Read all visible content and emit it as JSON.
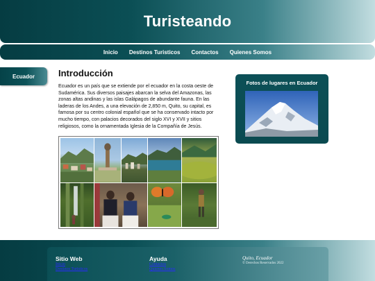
{
  "header": {
    "title": "Turisteando"
  },
  "nav": {
    "items": [
      {
        "label": "Inicio"
      },
      {
        "label": "Destinos Turisticos"
      },
      {
        "label": "Contactos"
      },
      {
        "label": "Quienes Somos"
      }
    ]
  },
  "sidebar": {
    "active_label": "Ecuador"
  },
  "main": {
    "heading": "Introducción",
    "paragraph": "Ecuador es un país que se extiende por el ecuador en la costa oeste de Sudamérica. Sus diversos paisajes abarcan la selva del Amazonas, las zonas altas andinas y las islas Galápagos de abundante fauna. En las laderas de los Andes, a una elevación de 2,850 m, Quito, su capital, es famosa por su centro colonial español que se ha conservado intacto por mucho tiempo, con palacios decorados del siglo XVI y XVII y sitios religiosos, como la ornamentada Iglesia de la Compañía de Jesús."
  },
  "photos_panel": {
    "title": "Fotos de lugares en Ecuador"
  },
  "footer": {
    "col1": {
      "heading": "Sitio Web",
      "links": [
        "Inicio",
        "Destinos Turisticos"
      ]
    },
    "col2": {
      "heading": "Ayuda",
      "links": [
        "Contactos",
        "Quienes Somos"
      ]
    },
    "city": "Quito, Ecuador",
    "copyright": "© Derechos Reservados 2022"
  },
  "colors": {
    "primary_teal": "#0b4f55",
    "light_teal": "#c2dde0",
    "link_blue": "#2a2aff"
  }
}
